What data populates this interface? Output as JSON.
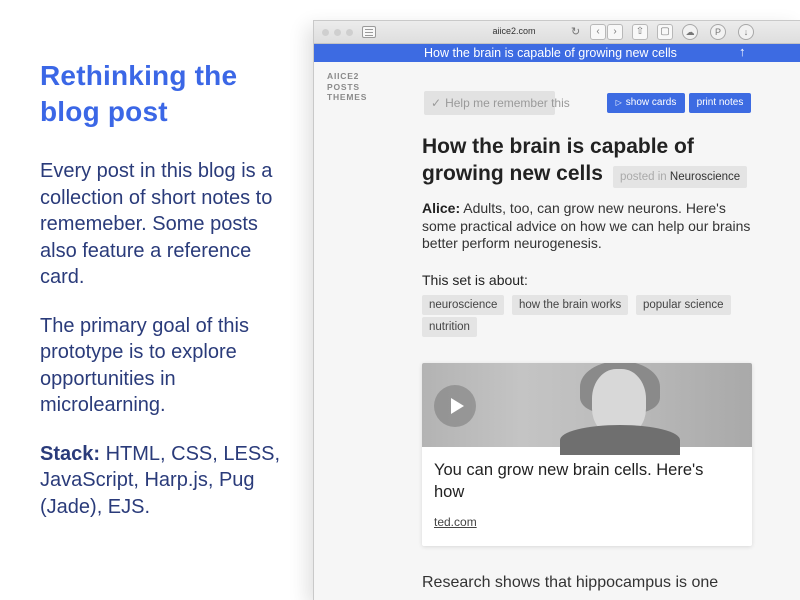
{
  "intro": {
    "title_line1": "Rethinking the",
    "title_line2": "blog post",
    "para1": "Every post in this blog is a collection of short notes to rememeber. Some posts also feature a reference card.",
    "para2": "The primary goal of this prototype is to explore opportunities in microlearning.",
    "stack_label": "Stack:",
    "stack_value": " HTML, CSS, LESS, JavaScript, Harp.js, Pug (Jade), EJS."
  },
  "browser": {
    "url": "aiice2.com",
    "icons": [
      "reload-icon",
      "back-icon",
      "forward-icon",
      "share-icon",
      "tabs-icon",
      "cloud-icon",
      "pinterest-icon",
      "download-icon"
    ]
  },
  "title_bar": {
    "text": "How the brain is capable of growing new cells",
    "scroll_icon": "↑"
  },
  "site_nav": {
    "items": [
      "AIICE2",
      "POSTS",
      "THEMES"
    ]
  },
  "controls": {
    "remember": "Help me remember this",
    "show_cards": "show cards",
    "print_notes": "print notes"
  },
  "post": {
    "title": "How the brain is capable of growing new cells",
    "posted_in_label": "posted in",
    "category": "Neuroscience",
    "author": "Alice:",
    "summary": " Adults, too, can grow new neurons. Here's some practical advice on how we can help our brains better perform neurogenesis.",
    "about_label": "This set is about:",
    "tags": [
      "neuroscience",
      "how the brain works",
      "popular science",
      "nutrition"
    ]
  },
  "card": {
    "title": "You can grow new brain cells. Here's how",
    "link": "ted.com"
  },
  "body_preview": "Research shows that hippocampus is one"
}
